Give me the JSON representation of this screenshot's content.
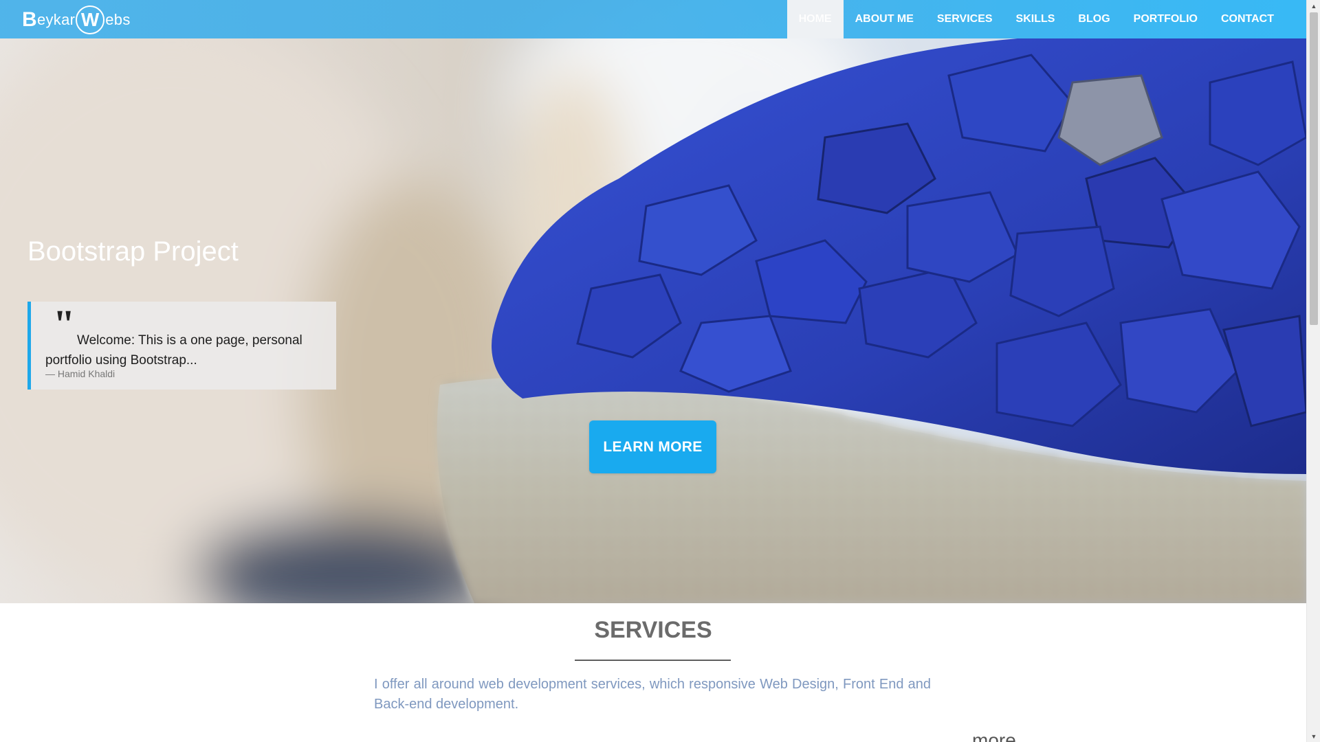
{
  "brand": {
    "prefix": "B",
    "middle": "eykar",
    "circle_letter": "W",
    "suffix": "ebs"
  },
  "nav": {
    "items": [
      {
        "label": "HOME",
        "active": true
      },
      {
        "label": "ABOUT ME",
        "active": false
      },
      {
        "label": "SERVICES",
        "active": false
      },
      {
        "label": "SKILLS",
        "active": false
      },
      {
        "label": "BLOG",
        "active": false
      },
      {
        "label": "PORTFOLIO",
        "active": false
      },
      {
        "label": "CONTACT",
        "active": false
      }
    ]
  },
  "hero": {
    "title": "Bootstrap Project",
    "quote_mark": "\"",
    "quote_text": "Welcome: This is a one page, personal portfolio using Bootstrap...",
    "quote_author": "— Hamid Khaldi",
    "button_label": "LEARN MORE"
  },
  "services": {
    "title": "SERVICES",
    "description": "I offer all around web development services, which responsive Web Design, Front End and Back-end development.",
    "more_label": "more"
  },
  "colors": {
    "navbar": "#3cace8",
    "accent": "#19aaef",
    "quote_border": "#1ea8ea",
    "services_text": "#7f98bf",
    "stone_blue": "#2b3fb8"
  },
  "icons": {
    "scroll_up": "triangle-up-icon",
    "scroll_down": "triangle-down-icon"
  }
}
